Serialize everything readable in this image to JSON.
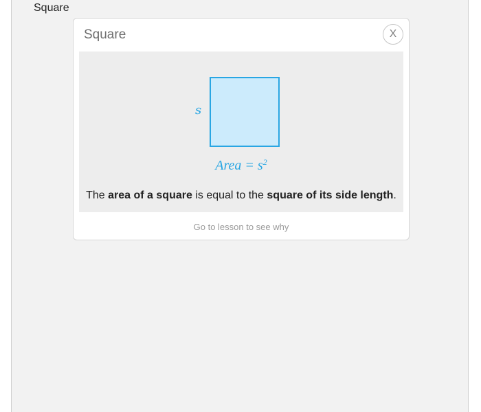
{
  "trigger": {
    "label": "Square"
  },
  "popup": {
    "title": "Square",
    "close_label": "X",
    "diagram": {
      "side_label": "s",
      "formula_base": "Area = s",
      "formula_exponent": "2"
    },
    "description": {
      "part1": "The ",
      "bold1": "area of a square",
      "part2": " is equal to the ",
      "bold2": "square of its side length",
      "part3": "."
    },
    "lesson_link": "Go to lesson to see why"
  },
  "colors": {
    "accent": "#29a6e3",
    "square_fill": "#ccebfc",
    "content_background": "#ededed",
    "page_background": "#f2f2f2"
  }
}
